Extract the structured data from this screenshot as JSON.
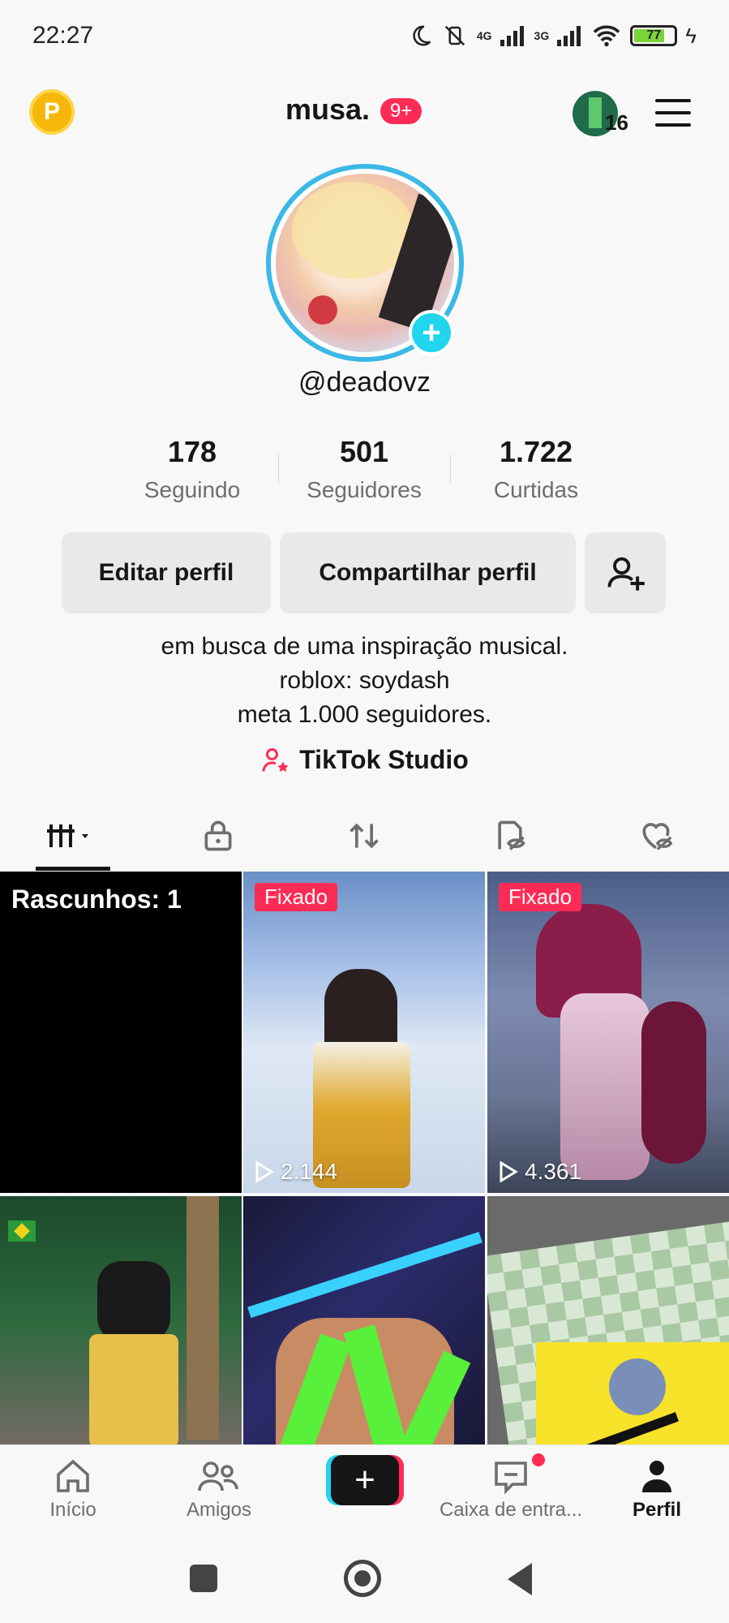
{
  "status_bar": {
    "time": "22:27",
    "network_1": "4G",
    "network_2": "3G",
    "battery": "77"
  },
  "header": {
    "coin_letter": "P",
    "app_name": "musa.",
    "notif_count": "9+",
    "mini_avatar_count": "16"
  },
  "profile": {
    "handle": "@deadovz",
    "stats": [
      {
        "value": "178",
        "label": "Seguindo"
      },
      {
        "value": "501",
        "label": "Seguidores"
      },
      {
        "value": "1.722",
        "label": "Curtidas"
      }
    ],
    "edit_label": "Editar perfil",
    "share_label": "Compartilhar perfil",
    "bio": [
      "em busca de uma inspiração musical.",
      "roblox: soydash",
      "meta 1.000 seguidores."
    ],
    "studio_label": "TikTok Studio"
  },
  "tabs": [
    "videos-grid-icon",
    "lock-icon",
    "repost-icon",
    "eye-off-icon",
    "heart-icon"
  ],
  "grid": {
    "draft_label": "Rascunhos: 1",
    "pinned_label": "Fixado",
    "items": [
      {
        "views": "2.144"
      },
      {
        "views": "4.361"
      }
    ]
  },
  "bottom_nav": {
    "home": "Início",
    "friends": "Amigos",
    "inbox": "Caixa de entra...",
    "profile": "Perfil"
  },
  "colors": {
    "accent": "#fe2c55",
    "teal": "#20d5ec"
  }
}
